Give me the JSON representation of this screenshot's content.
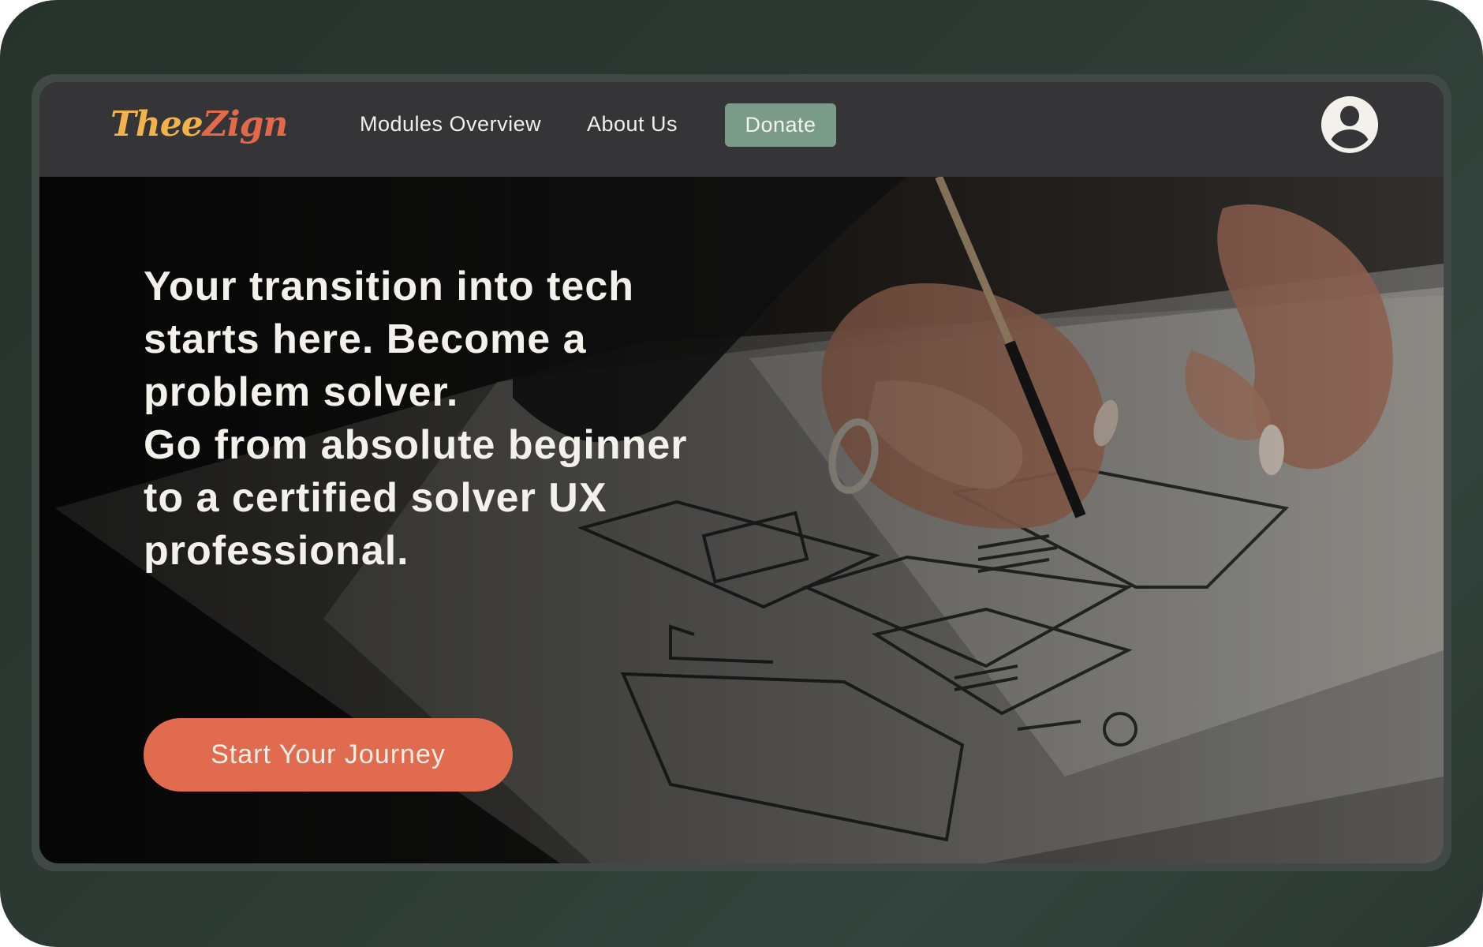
{
  "brand": {
    "logo_part1": "Thee",
    "logo_part2": "Zign",
    "logo_colors": [
      "#f2b24b",
      "#e4694a"
    ]
  },
  "nav": {
    "links": [
      "Modules Overview",
      "About Us"
    ],
    "donate_label": "Donate",
    "avatar_icon": "user-circle-icon"
  },
  "hero": {
    "lines": [
      "Your transition into tech",
      "starts here. Become a",
      "problem solver.",
      "Go from absolute beginner",
      "to a certified solver UX",
      "professional."
    ],
    "cta_label": "Start Your Journey"
  },
  "colors": {
    "navbar_bg": "#353538",
    "donate_bg": "#7a9b88",
    "cta_bg": "#e06b4e",
    "device_frame": "#2c3a33"
  }
}
